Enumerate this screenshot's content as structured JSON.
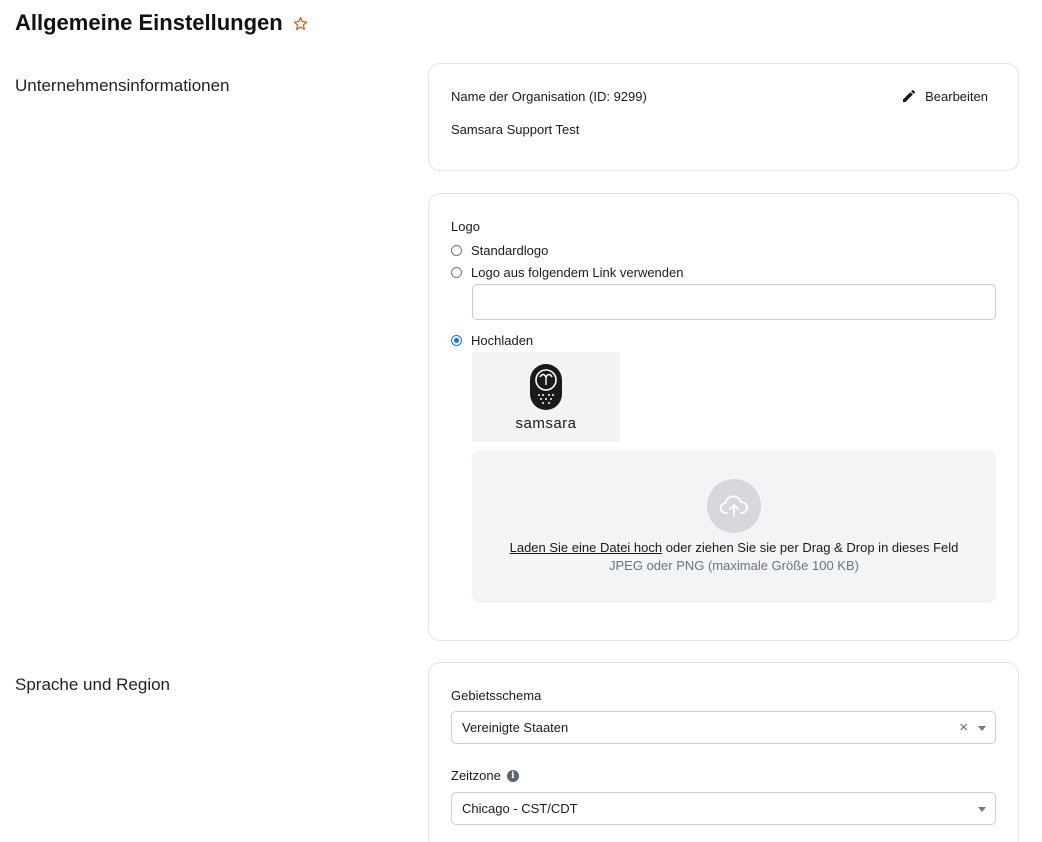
{
  "page": {
    "title": "Allgemeine Einstellungen",
    "favorite_icon": "star-outline-icon",
    "accent_color": "#c9621a"
  },
  "sections": {
    "company_label": "Unternehmensinformationen",
    "language_label": "Sprache und Region"
  },
  "org_card": {
    "name_label": "Name der Organisation (ID: 9299)",
    "name_value": "Samsara Support Test",
    "edit_label": "Bearbeiten",
    "edit_icon": "pencil-icon"
  },
  "logo_card": {
    "heading": "Logo",
    "options": [
      {
        "label": "Standardlogo",
        "checked": false
      },
      {
        "label": "Logo aus folgendem Link verwenden",
        "checked": false
      },
      {
        "label": "Hochladen",
        "checked": true
      }
    ],
    "link_input_value": "",
    "preview_wordmark": "samsara",
    "dropzone": {
      "upload_link": "Laden Sie eine Datei hoch",
      "upload_rest": " oder ziehen Sie sie per Drag & Drop in dieses Feld",
      "hint": "JPEG oder PNG (maximale Größe 100 KB)",
      "icon": "cloud-upload-icon"
    }
  },
  "region_card": {
    "locale_label": "Gebietsschema",
    "locale_value": "Vereinigte Staaten",
    "locale_clear": "×",
    "timezone_label": "Zeitzone",
    "timezone_info": "i",
    "timezone_value": "Chicago - CST/CDT"
  }
}
